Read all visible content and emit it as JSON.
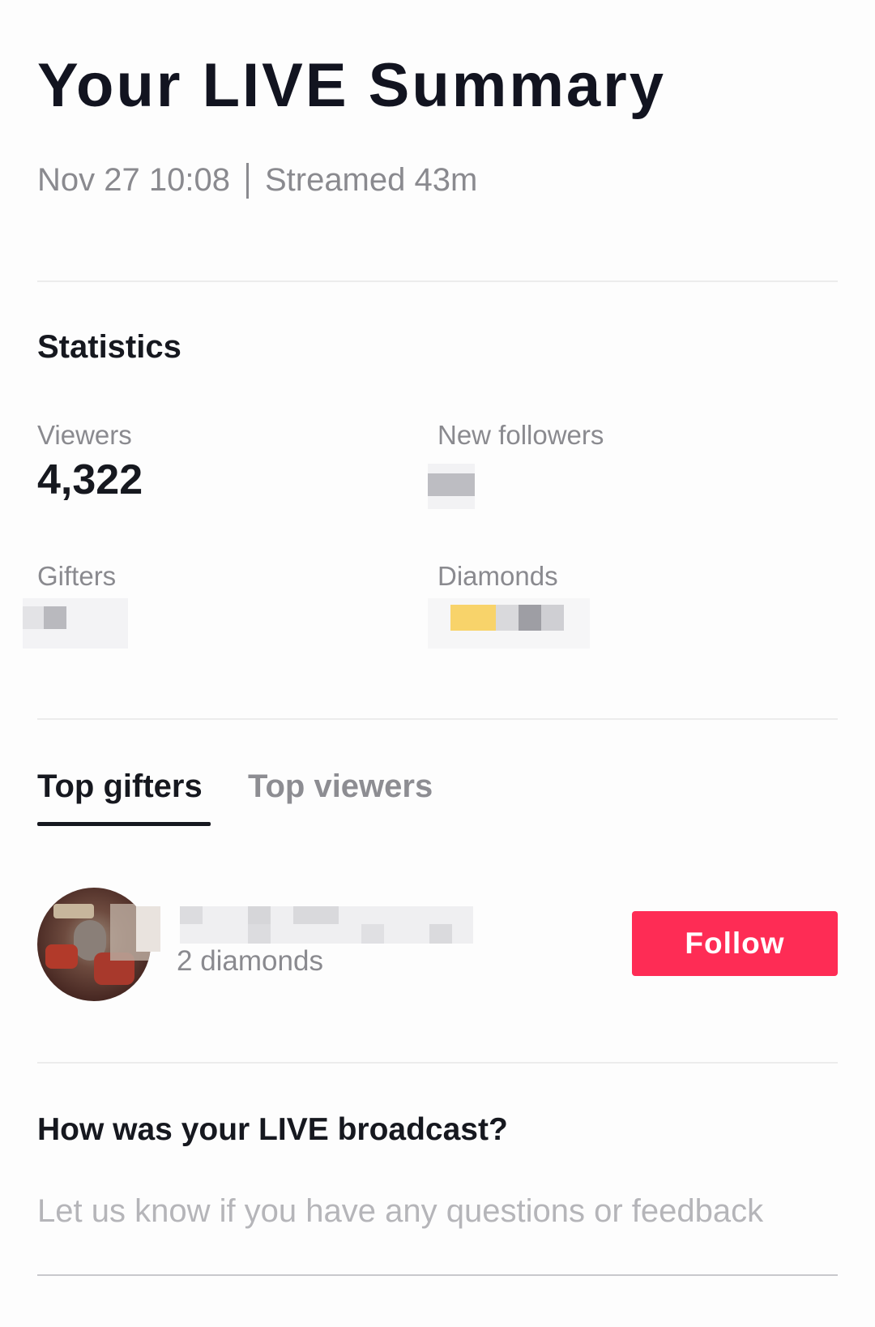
{
  "header": {
    "title": "Your LIVE Summary",
    "date": "Nov 27 10:08",
    "duration": "Streamed 43m"
  },
  "statistics": {
    "title": "Statistics",
    "viewers_label": "Viewers",
    "viewers_value": "4,322",
    "new_followers_label": "New followers",
    "gifters_label": "Gifters",
    "diamonds_label": "Diamonds"
  },
  "tabs": [
    {
      "label": "Top gifters",
      "active": true
    },
    {
      "label": "Top viewers",
      "active": false
    }
  ],
  "gifters": [
    {
      "subtitle": "2 diamonds",
      "action_label": "Follow"
    }
  ],
  "feedback": {
    "question": "How was your LIVE broadcast?",
    "placeholder": "Let us know if you have any questions or feedback"
  },
  "colors": {
    "accent": "#fe2c55",
    "text_primary": "#16181f",
    "text_secondary": "#8a8a8f"
  }
}
